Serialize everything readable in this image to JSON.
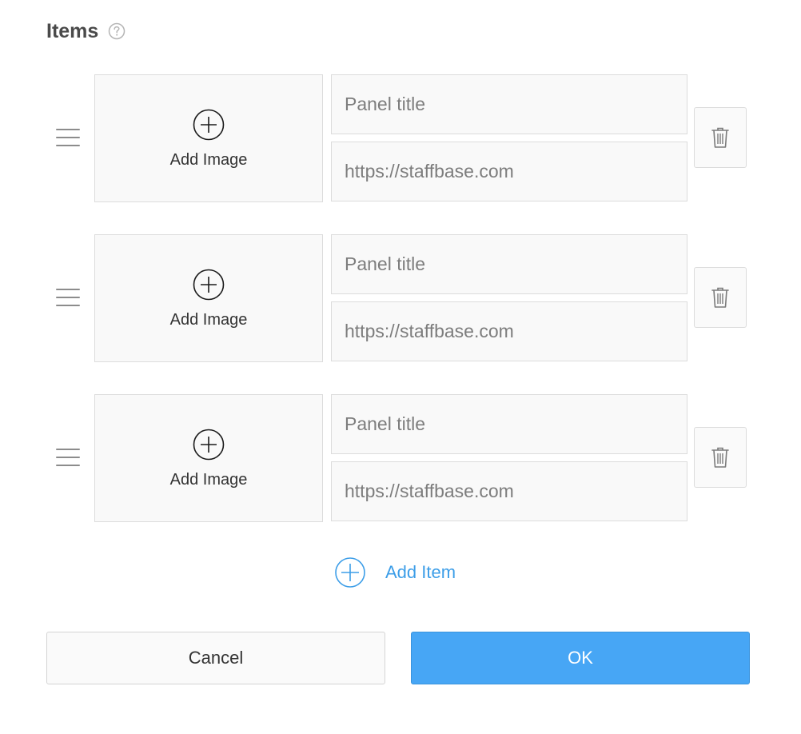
{
  "section": {
    "title": "Items",
    "help_icon": "question-circle-icon"
  },
  "items": [
    {
      "add_image_label": "Add Image",
      "title_placeholder": "Panel title",
      "url_placeholder": "https://staffbase.com"
    },
    {
      "add_image_label": "Add Image",
      "title_placeholder": "Panel title",
      "url_placeholder": "https://staffbase.com"
    },
    {
      "add_image_label": "Add Image",
      "title_placeholder": "Panel title",
      "url_placeholder": "https://staffbase.com"
    }
  ],
  "add_item": {
    "label": "Add Item",
    "icon": "plus-circle-icon"
  },
  "footer": {
    "cancel_label": "Cancel",
    "ok_label": "OK"
  },
  "icons": {
    "drag": "drag-handle-icon",
    "add_image": "plus-circle-icon",
    "delete": "trash-icon"
  },
  "colors": {
    "accent": "#47a6f5",
    "link": "#3d9ee8",
    "border": "#dcdcdc",
    "field_bg": "#f9f9f9"
  }
}
